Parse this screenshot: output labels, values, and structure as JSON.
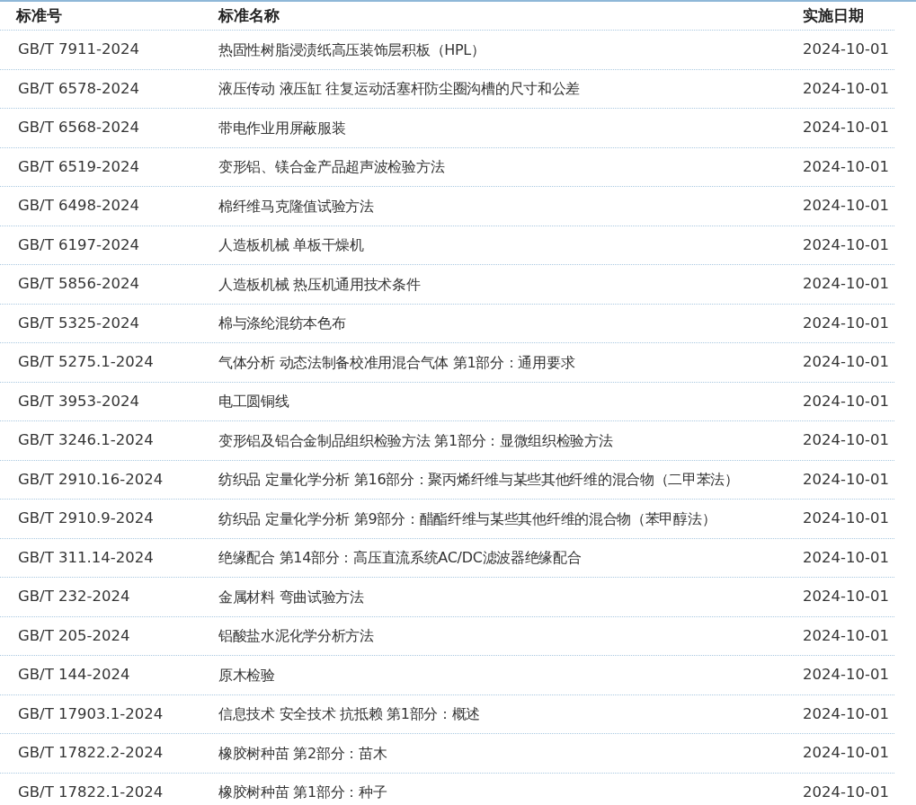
{
  "table": {
    "columns": [
      "标准号",
      "标准名称",
      "实施日期"
    ],
    "rows": [
      [
        "GB/T 7911-2024",
        "热固性树脂浸渍纸高压装饰层积板（HPL）",
        "2024-10-01"
      ],
      [
        "GB/T 6578-2024",
        "液压传动 液压缸 往复运动活塞杆防尘圈沟槽的尺寸和公差",
        "2024-10-01"
      ],
      [
        "GB/T 6568-2024",
        "带电作业用屏蔽服装",
        "2024-10-01"
      ],
      [
        "GB/T 6519-2024",
        "变形铝、镁合金产品超声波检验方法",
        "2024-10-01"
      ],
      [
        "GB/T 6498-2024",
        "棉纤维马克隆值试验方法",
        "2024-10-01"
      ],
      [
        "GB/T 6197-2024",
        "人造板机械 单板干燥机",
        "2024-10-01"
      ],
      [
        "GB/T 5856-2024",
        "人造板机械 热压机通用技术条件",
        "2024-10-01"
      ],
      [
        "GB/T 5325-2024",
        "棉与涤纶混纺本色布",
        "2024-10-01"
      ],
      [
        "GB/T 5275.1-2024",
        "气体分析 动态法制备校准用混合气体 第1部分：通用要求",
        "2024-10-01"
      ],
      [
        "GB/T 3953-2024",
        "电工圆铜线",
        "2024-10-01"
      ],
      [
        "GB/T 3246.1-2024",
        "变形铝及铝合金制品组织检验方法 第1部分：显微组织检验方法",
        "2024-10-01"
      ],
      [
        "GB/T 2910.16-2024",
        "纺织品 定量化学分析 第16部分：聚丙烯纤维与某些其他纤维的混合物（二甲苯法）",
        "2024-10-01"
      ],
      [
        "GB/T 2910.9-2024",
        "纺织品 定量化学分析 第9部分：醋酯纤维与某些其他纤维的混合物（苯甲醇法）",
        "2024-10-01"
      ],
      [
        "GB/T 311.14-2024",
        "绝缘配合 第14部分：高压直流系统AC/DC滤波器绝缘配合",
        "2024-10-01"
      ],
      [
        "GB/T 232-2024",
        "金属材料 弯曲试验方法",
        "2024-10-01"
      ],
      [
        "GB/T 205-2024",
        "铝酸盐水泥化学分析方法",
        "2024-10-01"
      ],
      [
        "GB/T 144-2024",
        "原木检验",
        "2024-10-01"
      ],
      [
        "GB/T 17903.1-2024",
        "信息技术 安全技术 抗抵赖 第1部分：概述",
        "2024-10-01"
      ],
      [
        "GB/T 17822.2-2024",
        "橡胶树种苗 第2部分：苗木",
        "2024-10-01"
      ],
      [
        "GB/T 17822.1-2024",
        "橡胶树种苗 第1部分：种子",
        "2024-10-01"
      ]
    ]
  }
}
